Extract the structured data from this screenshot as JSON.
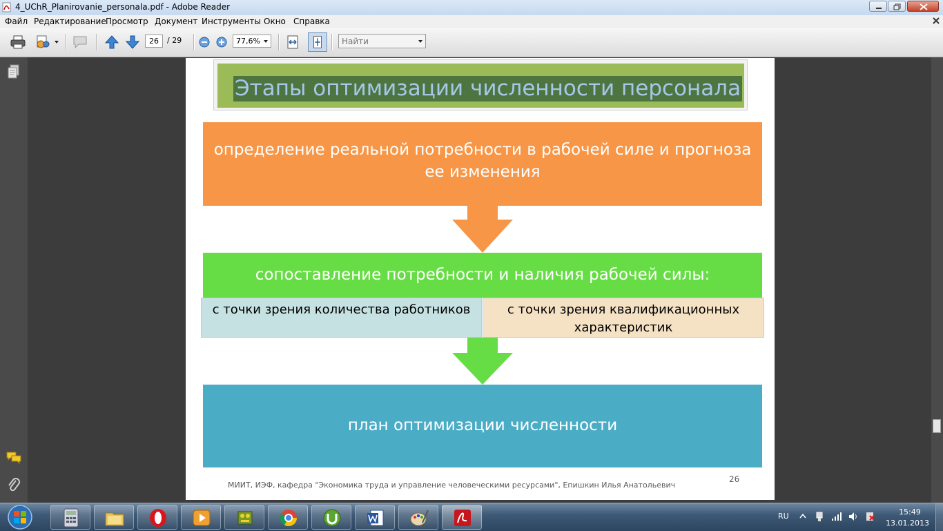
{
  "window": {
    "title": "4_UChR_Planirovanie_personala.pdf - Adobe Reader"
  },
  "menubar": {
    "items": [
      "Файл",
      "Редактирование",
      "Просмотр",
      "Документ",
      "Инструменты",
      "Окно",
      "Справка"
    ]
  },
  "toolbar": {
    "current_page": "26",
    "total_pages": "/ 29",
    "zoom": "77,6%",
    "find_placeholder": "Найти"
  },
  "document": {
    "slide_title": "Этапы оптимизации численности персонала",
    "box1": "определение реальной потребности в рабочей силе  и прогноза ее изменения",
    "box2": "сопоставление потребности и наличия рабочей силы:",
    "sub_left": "с точки зрения количества работников",
    "sub_right": "с точки зрения квалификационных характеристик",
    "box3": "план оптимизации численности",
    "footer": "МИИТ, ИЭФ, кафедра \"Экономика труда и управление человеческими ресурсами\", Епишкин Илья Анатольевич",
    "page_number": "26",
    "colors": {
      "title_bg": "#9bbb59",
      "orange": "#f79646",
      "green": "#66dd44",
      "teal": "#4bacc6"
    }
  },
  "taskbar": {
    "language": "RU",
    "time": "15:49",
    "date": "13.01.2013",
    "apps": [
      "calculator-icon",
      "folder-icon",
      "opera-icon",
      "media-player-icon",
      "puzzle-icon",
      "chrome-icon",
      "utorrent-icon",
      "word-icon",
      "paint-icon",
      "adobe-reader-icon"
    ]
  }
}
